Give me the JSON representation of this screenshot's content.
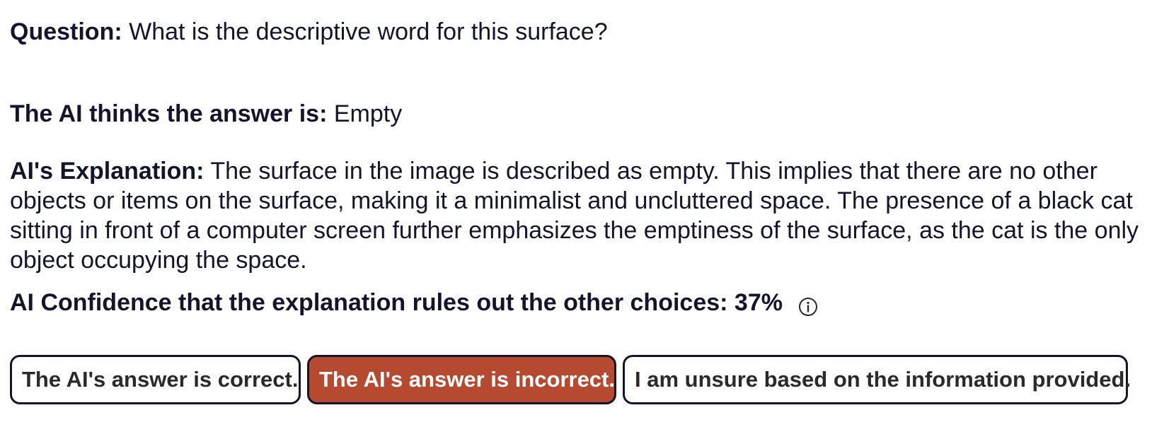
{
  "question": {
    "label": "Question:",
    "text": "What is the descriptive word for this surface?"
  },
  "answer": {
    "label": "The AI thinks the answer is:",
    "text": "Empty"
  },
  "explanation": {
    "label": "AI's Explanation:",
    "text": "The surface in the image is described as empty. This implies that there are no other objects or items on the surface, making it a minimalist and uncluttered space. The presence of a black cat sitting in front of a computer screen further emphasizes the emptiness of the surface, as the cat is the only object occupying the space."
  },
  "confidence": {
    "label": "AI Confidence that the explanation rules out the other choices:",
    "value": "37%",
    "icon": "info-icon"
  },
  "buttons": {
    "correct": "The AI's answer is correct.",
    "incorrect": "The AI's answer is incorrect.",
    "unsure": "I am unsure based on the information provided.",
    "selected": "incorrect",
    "selected_color": "#b64a30",
    "border_color": "#14142b"
  }
}
